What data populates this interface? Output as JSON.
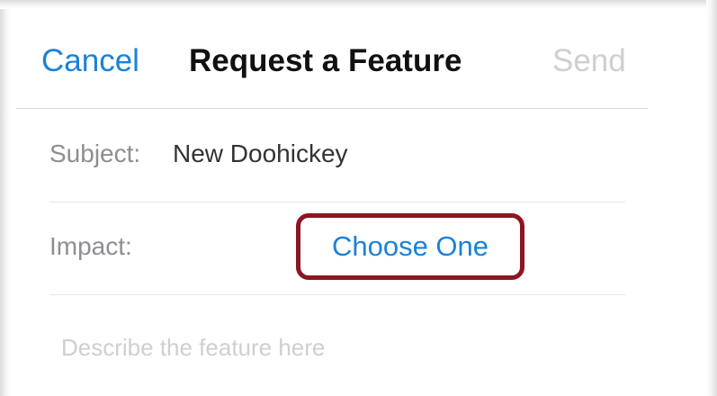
{
  "colors": {
    "accent": "#1a82d9",
    "disabled": "#cfcfcf",
    "label": "#8e8e93",
    "text": "#333333",
    "highlight_border": "#8c1620"
  },
  "nav": {
    "cancel_label": "Cancel",
    "title": "Request a Feature",
    "send_label": "Send"
  },
  "form": {
    "subject": {
      "label": "Subject:",
      "value": "New Doohickey"
    },
    "impact": {
      "label": "Impact:",
      "selected": "Choose One"
    },
    "description": {
      "placeholder": "Describe the feature here",
      "value": ""
    }
  }
}
